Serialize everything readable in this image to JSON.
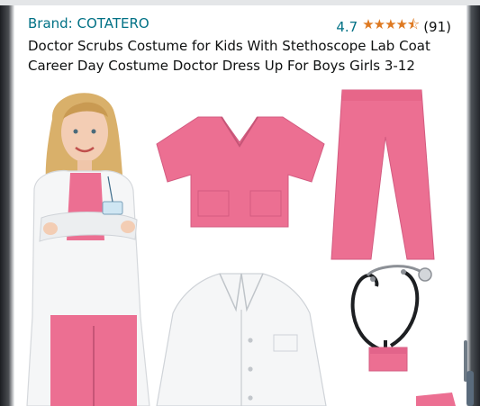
{
  "product": {
    "brand_label": "Brand: COTATERO",
    "rating_value": "4.7",
    "rating_stars": "★★★★⯪",
    "rating_count": "(91)",
    "title": "Doctor Scrubs Costume for Kids With Stethoscope Lab Coat Career Day Costume Doctor Dress Up For Boys Girls 3-12"
  },
  "colors": {
    "link": "#007185",
    "star": "#de7921",
    "scrubs_pink": "#ec6f92",
    "coat_white": "#f5f6f7"
  },
  "icons": [
    "star-rating-icon"
  ]
}
